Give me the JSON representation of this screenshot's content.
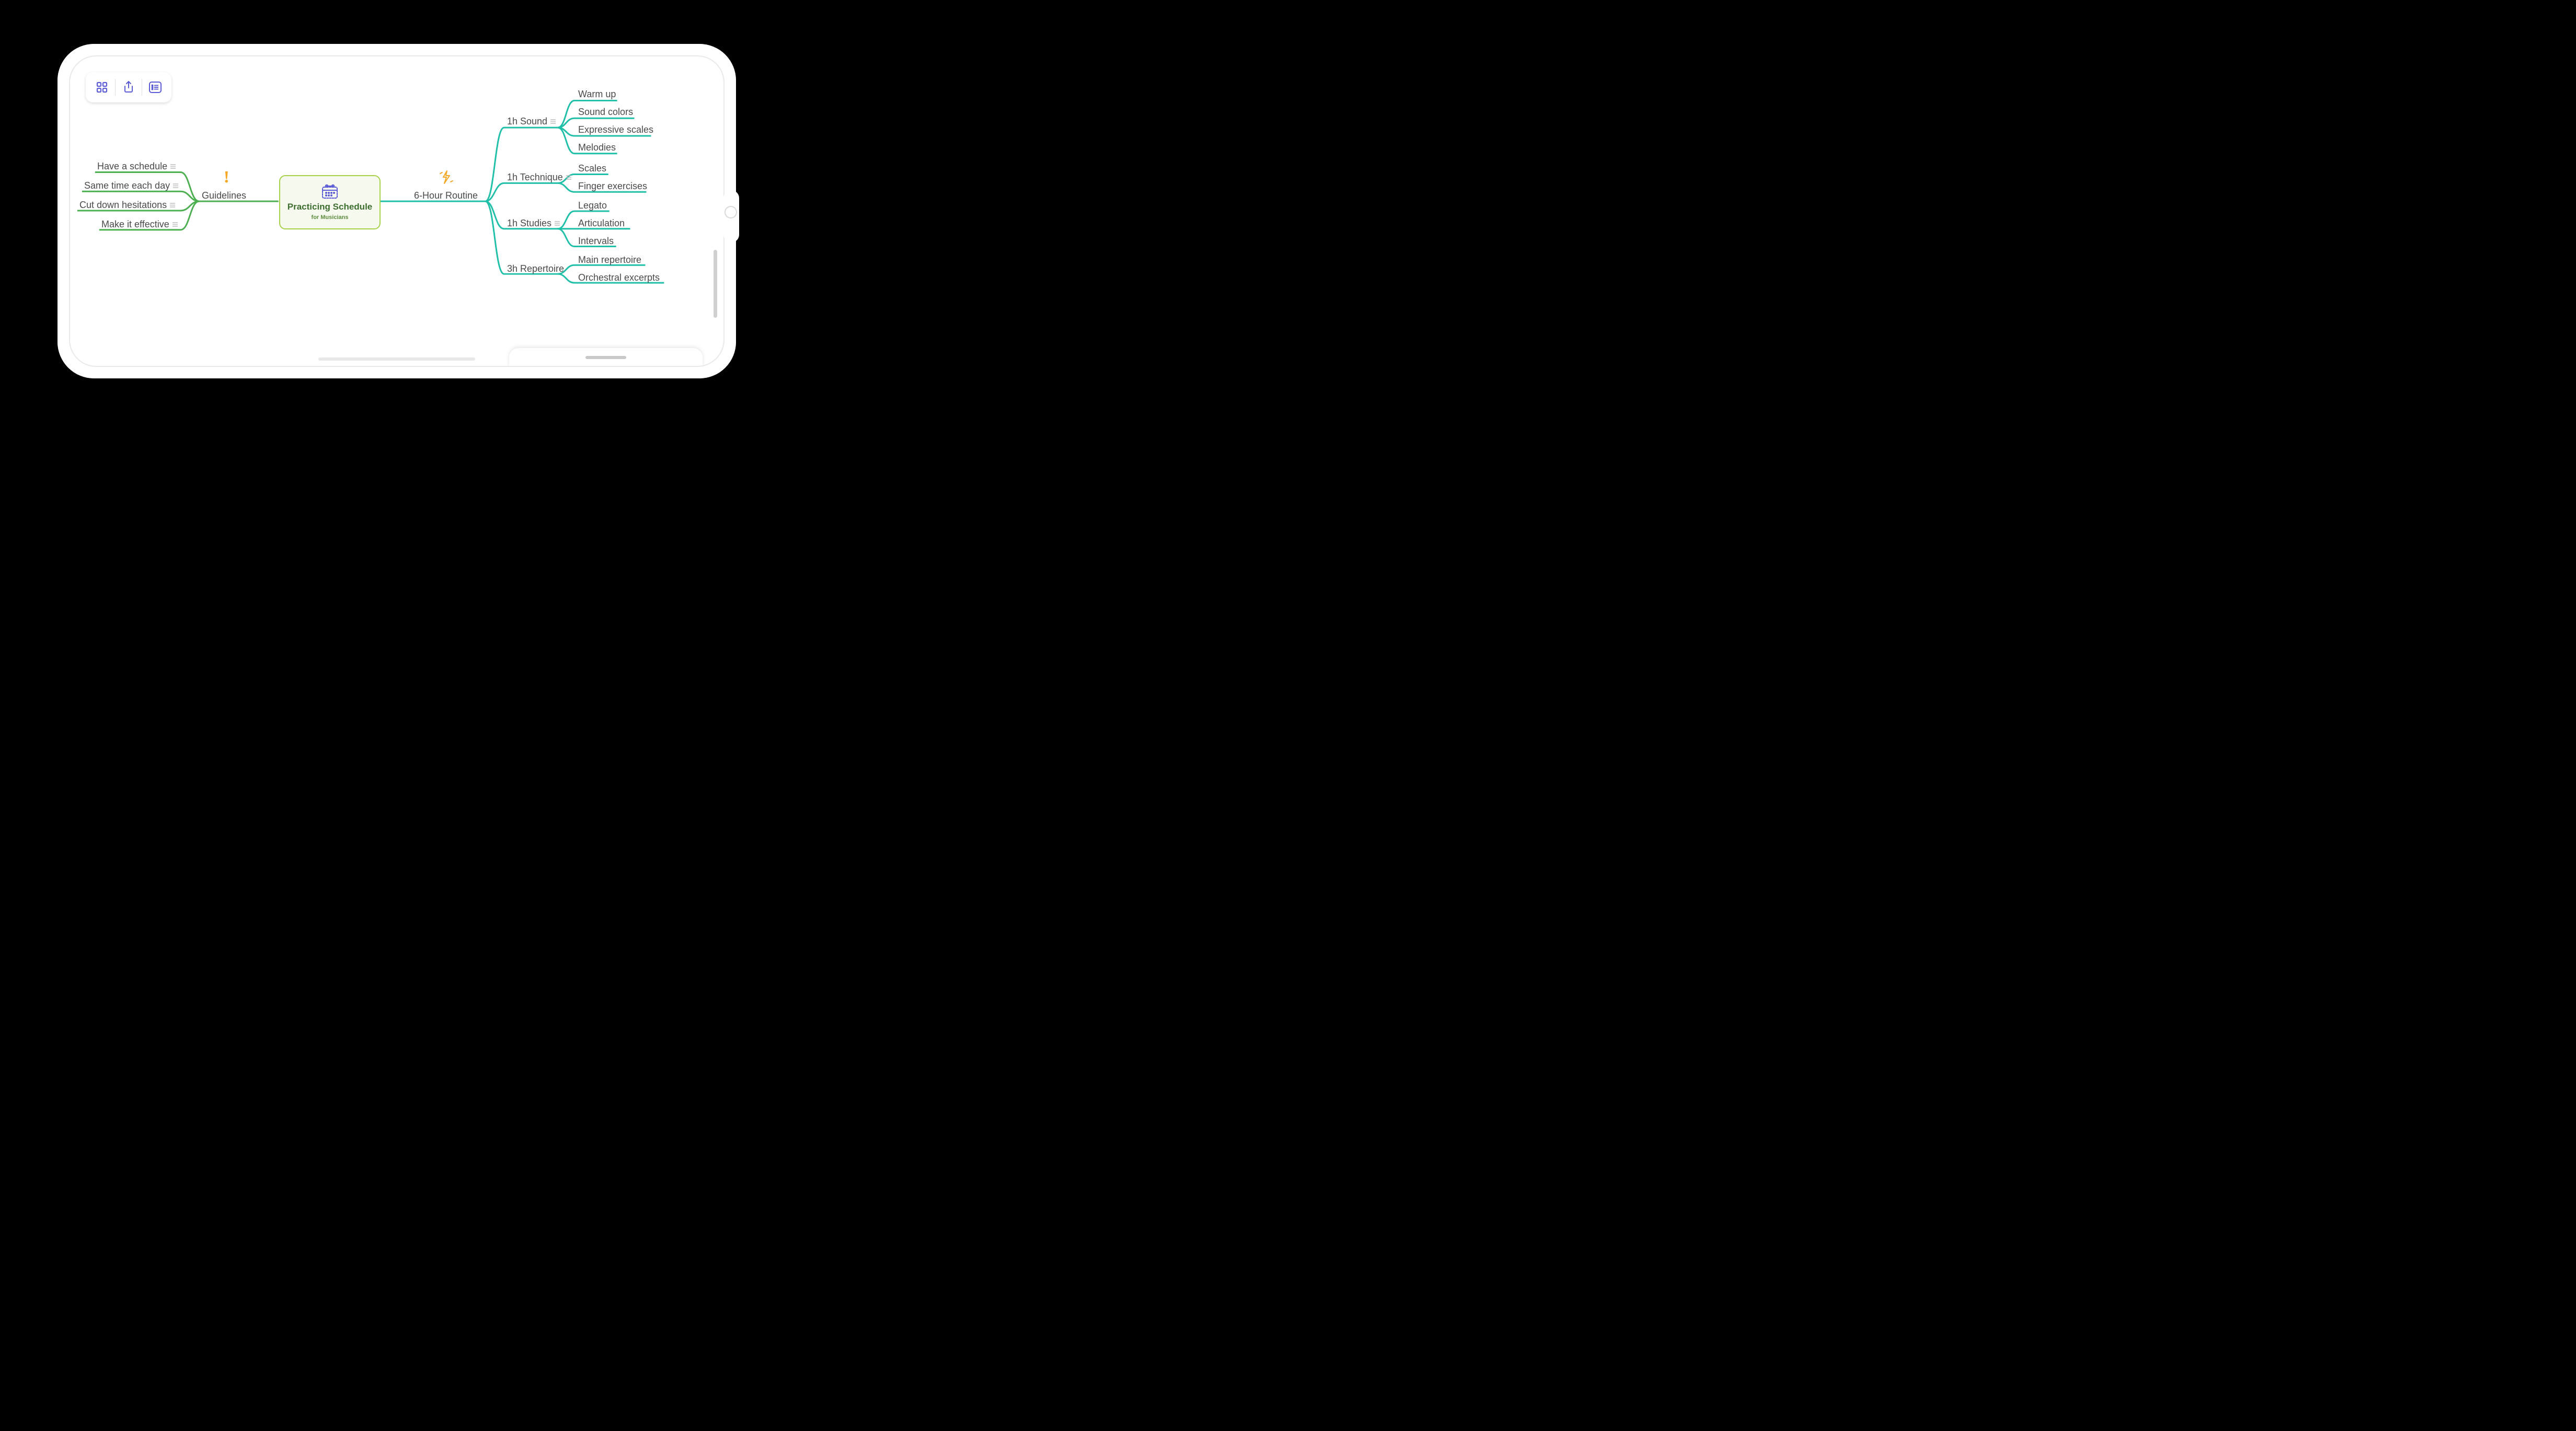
{
  "central": {
    "title": "Practicing Schedule",
    "subtitle": "for Musicians",
    "icon": "calendar-icon"
  },
  "left_branch": {
    "label": "Guidelines",
    "icon": "exclamation-icon",
    "color": "#4CAF50",
    "items": [
      {
        "label": "Have a schedule",
        "has_note": true
      },
      {
        "label": "Same time each day",
        "has_note": true
      },
      {
        "label": "Cut down hesitations",
        "has_note": true
      },
      {
        "label": "Make it effective",
        "has_note": true
      }
    ]
  },
  "right_branch": {
    "label": "6-Hour Routine",
    "icon": "lightning-icon",
    "color": "#1FBFA8",
    "children": [
      {
        "label": "1h Sound",
        "has_note": true,
        "items": [
          {
            "label": "Warm up"
          },
          {
            "label": "Sound colors"
          },
          {
            "label": "Expressive scales"
          },
          {
            "label": "Melodies"
          }
        ]
      },
      {
        "label": "1h Technique",
        "has_note": true,
        "items": [
          {
            "label": "Scales"
          },
          {
            "label": "Finger exercises"
          }
        ]
      },
      {
        "label": "1h Studies",
        "has_note": true,
        "items": [
          {
            "label": "Legato"
          },
          {
            "label": "Articulation"
          },
          {
            "label": "Intervals"
          }
        ]
      },
      {
        "label": "3h Repertoire",
        "has_note": false,
        "items": [
          {
            "label": "Main repertoire"
          },
          {
            "label": "Orchestral excerpts"
          }
        ]
      }
    ]
  },
  "toolbar": {
    "grid_label": "Layouts",
    "share_label": "Share",
    "list_label": "Outline"
  },
  "colors": {
    "lime_border": "#A8D14A",
    "green_branch": "#4CAF50",
    "teal_branch": "#1FBFA8",
    "indigo": "#5B5BD6",
    "amber": "#F5A623"
  }
}
